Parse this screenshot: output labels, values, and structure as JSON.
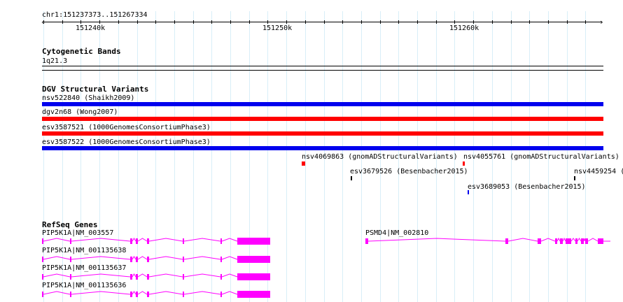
{
  "ruler": {
    "location": "chr1:151237373..151267334",
    "major_ticks": [
      "151240k",
      "151250k",
      "151260k"
    ]
  },
  "cytoband": {
    "title": "Cytogenetic Bands",
    "band": "1q21.3"
  },
  "dgv": {
    "title": "DGV Structural Variants",
    "variants": [
      {
        "label": "nsv522840 (Shaikh2009)",
        "color": "#0000ee"
      },
      {
        "label": "dgv2n68 (Wong2007)",
        "color": "#ff0000"
      },
      {
        "label": "esv3587521 (1000GenomesConsortiumPhase3)",
        "color": "#ff0000"
      },
      {
        "label": "esv3587522 (1000GenomesConsortiumPhase3)",
        "color": "#0000ee"
      },
      {
        "label": "nsv4069863 (gnomADStructuralVariants)",
        "color": "#ff0000"
      },
      {
        "label": "nsv4055761 (gnomADStructuralVariants)",
        "color": "#ff0000"
      },
      {
        "label": "esv3679526 (Besenbacher2015)",
        "color": "#000000"
      },
      {
        "label": "nsv4459254 (",
        "color": "#000000"
      },
      {
        "label": "esv3689053 (Besenbacher2015)",
        "color": "#0000ee"
      }
    ]
  },
  "refseq": {
    "title": "RefSeq Genes",
    "color": "#ff00ff",
    "genes": [
      {
        "label": "PIP5K1A|NM_003557"
      },
      {
        "label": "PIP5K1A|NM_001135638"
      },
      {
        "label": "PIP5K1A|NM_001135637"
      },
      {
        "label": "PIP5K1A|NM_001135636"
      },
      {
        "label": "PSMD4|NM_002810"
      }
    ]
  }
}
